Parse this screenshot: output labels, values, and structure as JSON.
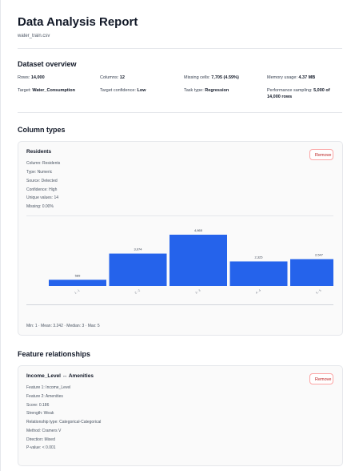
{
  "report": {
    "title": "Data Analysis Report",
    "file": "water_train.csv"
  },
  "overview": {
    "heading": "Dataset overview",
    "items": [
      {
        "label": "Rows:",
        "value": "14,000"
      },
      {
        "label": "Columns:",
        "value": "12"
      },
      {
        "label": "Missing cells:",
        "value": "7,705 (4.59%)"
      },
      {
        "label": "Memory usage:",
        "value": "4.37 MB"
      },
      {
        "label": "Target:",
        "value": "Water_Consumption"
      },
      {
        "label": "Target confidence:",
        "value": "Low"
      },
      {
        "label": "Task type:",
        "value": "Regression"
      },
      {
        "label": "Performance sampling:",
        "value": "5,000 of 14,000 rows"
      }
    ]
  },
  "column_types": {
    "heading": "Column types",
    "card": {
      "title": "Residents",
      "remove_label": "Remove",
      "details": [
        "Column: Residents",
        "Type: Numeric",
        "Source: Detected",
        "Confidence: High",
        "Unique values: 14",
        "Missing: 0.00%"
      ],
      "stats": "Min: 1 · Mean: 3.242 · Median: 3 · Max: 5"
    }
  },
  "chart_data": {
    "type": "bar",
    "categories": [
      "1 - 1",
      "2 - 2",
      "3 - 3",
      "4 - 4",
      "5 - 5"
    ],
    "values": [
      589,
      3074,
      4865,
      2325,
      2547
    ],
    "value_labels": [
      "589",
      "3,074",
      "4,865",
      "2,325",
      "2,547"
    ],
    "ylim": [
      0,
      4865
    ],
    "title": "",
    "xlabel": "",
    "ylabel": "",
    "grid": false,
    "colors": {
      "bar": "#2563eb"
    }
  },
  "relationships": {
    "heading": "Feature relationships",
    "card": {
      "title": "Income_Level ↔ Amenities",
      "remove_label": "Remove",
      "details": [
        "Feature 1: Income_Level",
        "Feature 2: Amenities",
        "Score: 0.186",
        "Strength: Weak",
        "Relationship type: Categorical-Categorical",
        "Method: Cramers V",
        "Direction: Mixed",
        "P-value: < 0.001"
      ]
    }
  },
  "colors": {
    "accent": "#2563eb",
    "danger": "#b91c1c"
  }
}
